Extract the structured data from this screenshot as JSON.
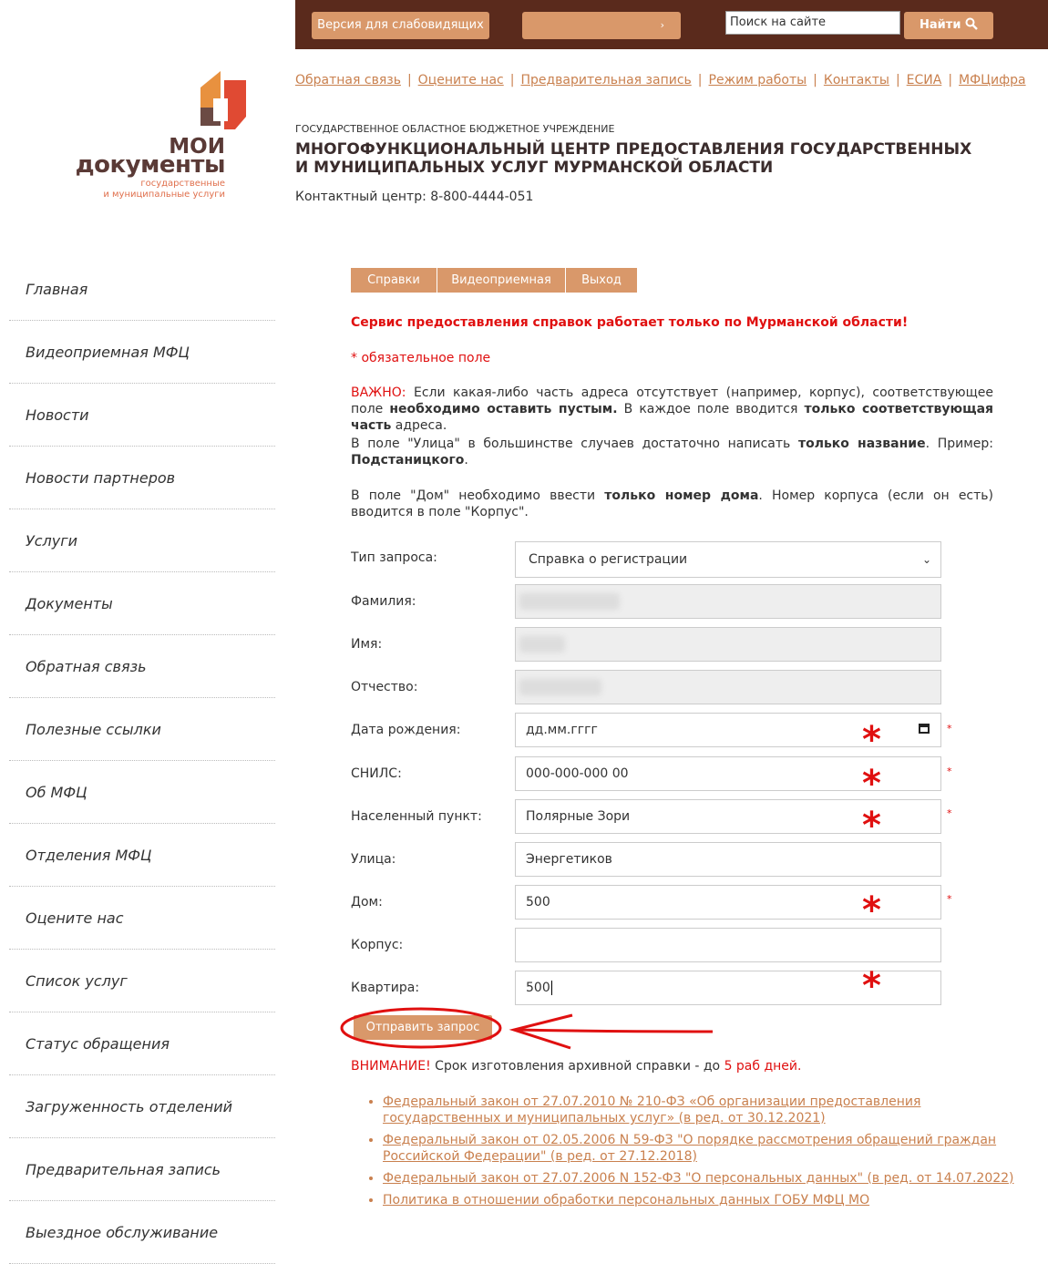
{
  "topbar": {
    "vision_label": "Версия для слабовидящих",
    "lang_label": "",
    "search_placeholder": "Поиск на сайте",
    "find_label": "Найти"
  },
  "logo": {
    "word1": "МОИ",
    "word2": "документы",
    "sub1": "государственные",
    "sub2": "и муниципальные услуги"
  },
  "header_links": [
    "Обратная связь",
    "Оцените нас",
    "Предварительная запись",
    "Режим работы",
    "Контакты",
    "ЕСИА",
    "МФЦифра"
  ],
  "org": {
    "small": "ГОСУДАРСТВЕННОЕ ОБЛАСТНОЕ БЮДЖЕТНОЕ УЧРЕЖДЕНИЕ",
    "title": "МНОГОФУНКЦИОНАЛЬНЫЙ ЦЕНТР ПРЕДОСТАВЛЕНИЯ ГОСУДАРСТВЕННЫХ И МУНИЦИПАЛЬНЫХ УСЛУГ МУРМАНСКОЙ ОБЛАСТИ",
    "contact": "Контактный центр: 8-800-4444-051"
  },
  "sidebar": [
    "Главная",
    "Видеоприемная МФЦ",
    "Новости",
    "Новости партнеров",
    "Услуги",
    "Документы",
    "Обратная связь",
    "Полезные ссылки",
    "Об МФЦ",
    "Отделения МФЦ",
    "Оцените нас",
    "Список услуг",
    "Статус обращения",
    "Загруженность отделений",
    "Предварительная запись",
    "Выездное обслуживание"
  ],
  "tabs": [
    "Справки",
    "Видеоприемная",
    "Выход"
  ],
  "notice": "Сервис предоставления справок работает только по Мурманской области!",
  "required_note": "* обязательное поле",
  "para1": {
    "important": "ВАЖНО:",
    "t1": " Если какая-либо часть адреса отсутствует (например, корпус), соответствующее поле ",
    "b1": "необходимо оставить пустым.",
    "t2": " В каждое поле вводится ",
    "b2": "только соответствующая часть",
    "t3": " адреса."
  },
  "para2": {
    "t1": "В поле \"Улица\" в большинстве случаев достаточно написать ",
    "b1": "только название",
    "t2": ". Пример: ",
    "b2": "Подстаницкого",
    "t3": "."
  },
  "para3": {
    "t1": "В поле \"Дом\" необходимо ввести ",
    "b1": "только номер дома",
    "t2": ". Номер корпуса (если он есть) вводится в поле \"Корпус\"."
  },
  "form": {
    "type_label": "Тип запроса:",
    "type_value": "Справка о регистрации",
    "surname_label": "Фамилия:",
    "name_label": "Имя:",
    "patronymic_label": "Отчество:",
    "birth_label": "Дата рождения:",
    "birth_placeholder": "дд.мм.гггг",
    "snils_label": "СНИЛС:",
    "snils_placeholder": "000-000-000 00",
    "city_label": "Населенный пункт:",
    "city_value": "Полярные Зори",
    "street_label": "Улица:",
    "street_value": "Энергетиков",
    "house_label": "Дом:",
    "house_value": "500",
    "building_label": "Корпус:",
    "building_value": "",
    "flat_label": "Квартира:",
    "flat_value": "500",
    "submit_label": "Отправить запрос",
    "star": "*"
  },
  "attention": {
    "word": "ВНИМАНИЕ!",
    "text": " Срок изготовления архивной справки - до ",
    "days": "5 раб дней."
  },
  "laws": [
    "Федеральный закон от 27.07.2010 № 210-ФЗ «Об организации предоставления государственных и муниципальных услуг» (в ред. от 30.12.2021)",
    "Федеральный закон от 02.05.2006 N 59-ФЗ \"О порядке рассмотрения обращений граждан Российской Федерации\" (в ред. от 27.12.2018)",
    "Федеральный закон от 27.07.2006 N 152-ФЗ \"О персональных данных\" (в ред. от 14.07.2022)",
    "Политика в отношении обработки персональных данных ГОБУ МФЦ МО"
  ],
  "colors": {
    "accent": "#d9986a",
    "topbar": "#5a2a1c",
    "link": "#c9804e",
    "red": "#e01010"
  }
}
